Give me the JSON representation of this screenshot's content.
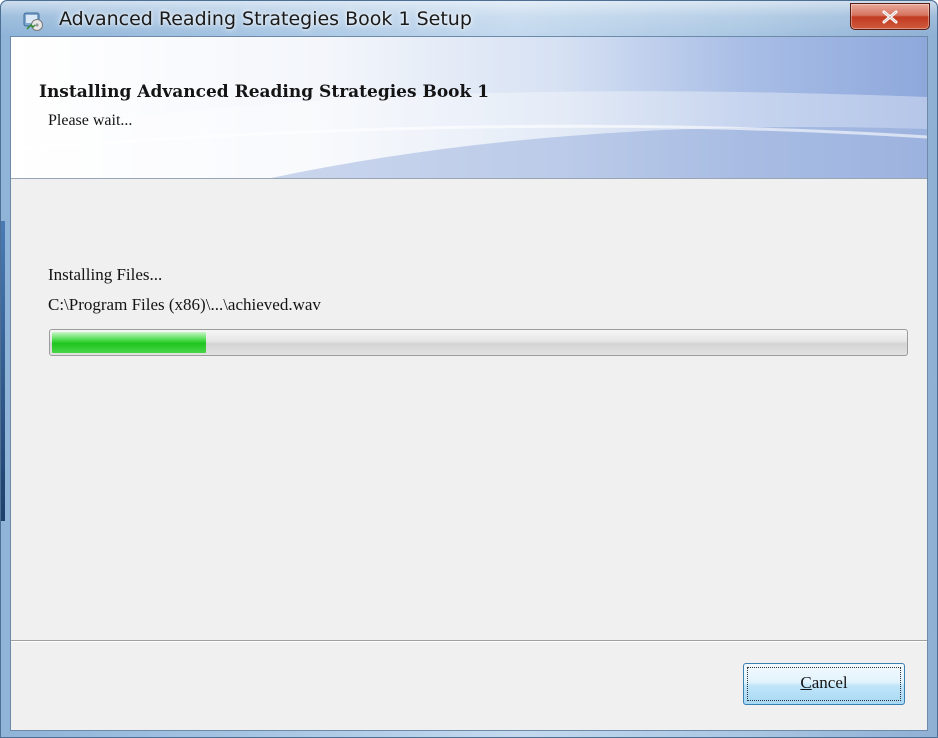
{
  "window": {
    "title": "Advanced Reading Strategies Book 1 Setup",
    "app_icon": "installer-icon",
    "close_icon": "close-icon"
  },
  "banner": {
    "title": "Installing Advanced Reading Strategies Book 1",
    "subtitle": "Please wait..."
  },
  "content": {
    "status_text": "Installing Files...",
    "current_file": "C:\\Program Files (x86)\\...\\achieved.wav",
    "progress_fraction": 0.18,
    "progress_color": "#1fc41f"
  },
  "footer": {
    "cancel_label": {
      "mnemonic": "C",
      "rest": "ancel"
    }
  },
  "colors": {
    "close_button": "#c23b21",
    "banner_accent": "#8ea8dc"
  }
}
